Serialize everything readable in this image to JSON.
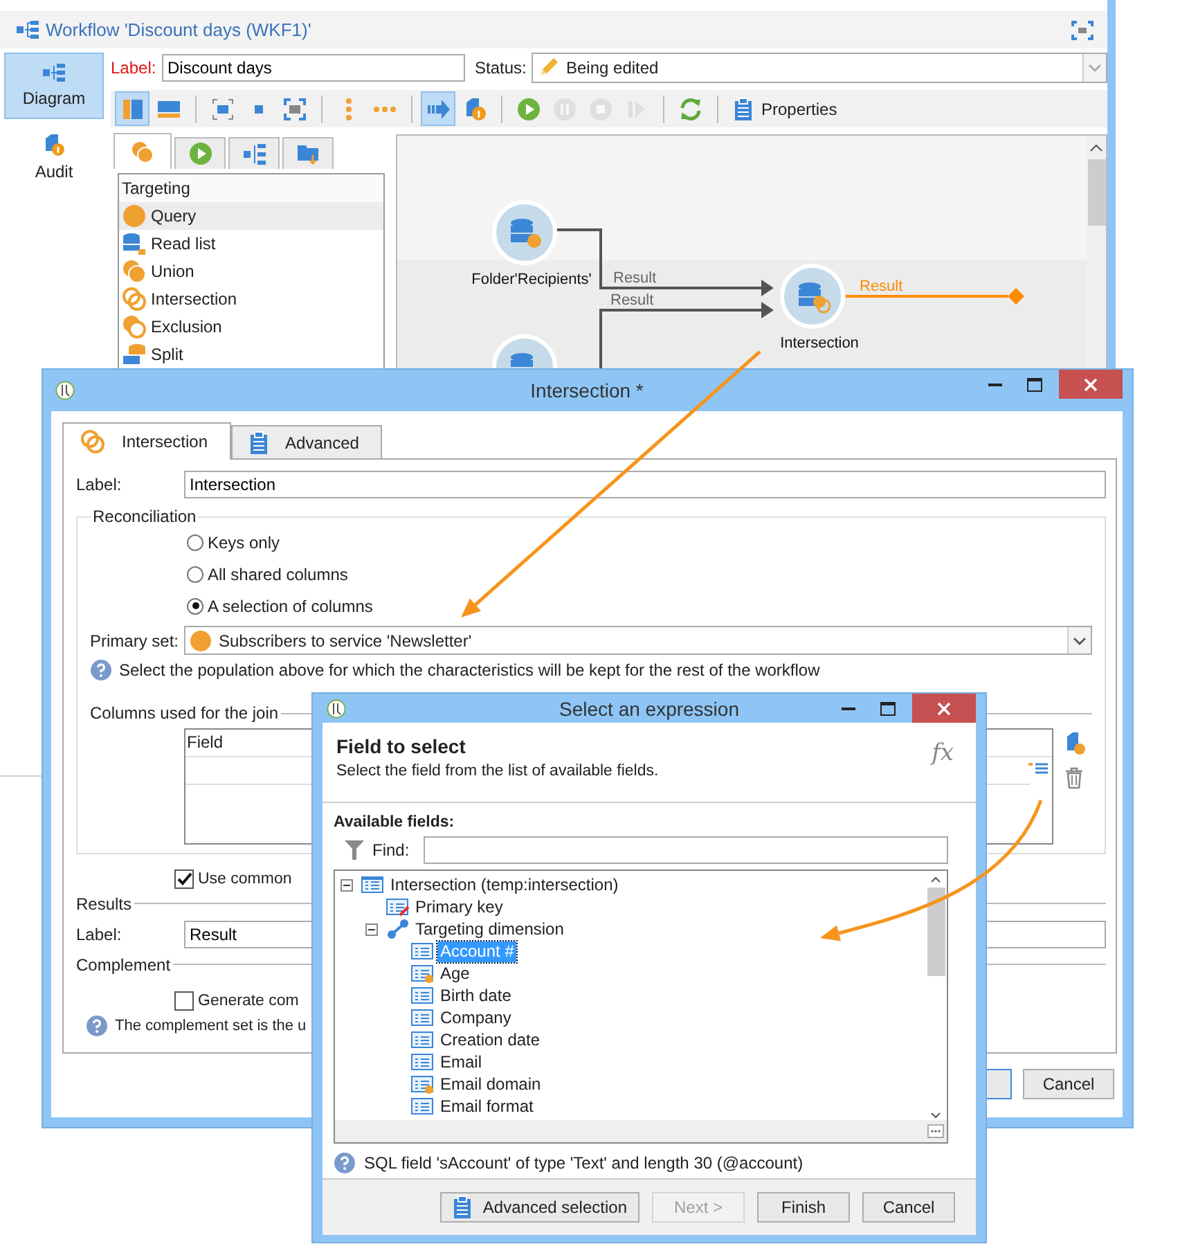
{
  "workflow_window": {
    "title": "Workflow 'Discount days (WKF1)'",
    "sidebar": [
      {
        "label": "Diagram",
        "kind": "diagram",
        "selected": true
      },
      {
        "label": "Audit",
        "kind": "audit",
        "selected": false
      }
    ],
    "label_caption": "Label:",
    "label_value": "Discount days",
    "status_caption": "Status:",
    "status_value": "Being edited",
    "toolbar": {
      "groups": [
        [
          {
            "kind": "vertical-split",
            "pressed": true,
            "disabled": false
          },
          {
            "kind": "horizontal-split",
            "pressed": false,
            "disabled": false
          }
        ],
        [
          {
            "kind": "fit",
            "pressed": false,
            "disabled": false
          },
          {
            "kind": "small-square",
            "pressed": false,
            "disabled": false
          },
          {
            "kind": "fullscreen",
            "pressed": false,
            "disabled": false
          }
        ],
        [
          {
            "kind": "vertical-dots",
            "pressed": false,
            "disabled": false
          },
          {
            "kind": "horizontal-dots",
            "pressed": false,
            "disabled": false
          }
        ],
        [
          {
            "kind": "arrow-right",
            "pressed": true,
            "disabled": false
          },
          {
            "kind": "doc-info",
            "pressed": false,
            "disabled": false
          }
        ],
        [
          {
            "kind": "play",
            "pressed": false,
            "disabled": false
          },
          {
            "kind": "pause",
            "pressed": false,
            "disabled": true
          },
          {
            "kind": "stop",
            "pressed": false,
            "disabled": true
          },
          {
            "kind": "step",
            "pressed": false,
            "disabled": true
          }
        ],
        [
          {
            "kind": "refresh",
            "pressed": false,
            "disabled": false
          }
        ]
      ],
      "properties_label": "Properties"
    },
    "palette": {
      "tabs": [
        {
          "kind": "targeting",
          "selected": true
        },
        {
          "kind": "flow",
          "selected": false
        },
        {
          "kind": "actions",
          "selected": false
        },
        {
          "kind": "tools",
          "selected": false
        }
      ],
      "heading": "Targeting",
      "items": [
        {
          "label": "Query",
          "kind": "query",
          "selected": true
        },
        {
          "label": "Read list",
          "kind": "read-list",
          "selected": false
        },
        {
          "label": "Union",
          "kind": "union",
          "selected": false
        },
        {
          "label": "Intersection",
          "kind": "intersection",
          "selected": false
        },
        {
          "label": "Exclusion",
          "kind": "exclusion",
          "selected": false
        },
        {
          "label": "Split",
          "kind": "split",
          "selected": false
        }
      ]
    },
    "diagram": {
      "nodes": [
        {
          "kind": "query",
          "label": "Folder'Recipients'"
        },
        {
          "kind": "query"
        },
        {
          "kind": "intersection",
          "label": "Intersection"
        }
      ],
      "transitions": [
        {
          "label": "Result",
          "active": false
        },
        {
          "label": "Result",
          "active": false
        },
        {
          "label": "Result",
          "active": true
        }
      ]
    }
  },
  "intersection_dialog": {
    "title": "Intersection *",
    "tabs": [
      {
        "label": "Intersection",
        "kind": "intersection",
        "selected": true
      },
      {
        "label": "Advanced",
        "kind": "advanced",
        "selected": false
      }
    ],
    "label_caption": "Label:",
    "label_value": "Intersection",
    "reconciliation": {
      "legend": "Reconciliation",
      "options": [
        {
          "label": "Keys only",
          "selected": false
        },
        {
          "label": "All shared columns",
          "selected": false
        },
        {
          "label": "A selection of columns",
          "selected": true
        }
      ],
      "primary_set_caption": "Primary set:",
      "primary_set_value": "Subscribers to service 'Newsletter'",
      "hint": "Select the population above for which the characteristics will be kept for the rest of the workflow"
    },
    "columns": {
      "legend": "Columns used for the join",
      "header": "Field"
    },
    "use_common": {
      "label": "Use common",
      "checked": true
    },
    "results": {
      "legend": "Results",
      "label_caption": "Label:",
      "label_value": "Result"
    },
    "complement": {
      "legend": "Complement",
      "checkbox": {
        "label": "Generate com",
        "checked": false
      },
      "hint": "The complement set is the u"
    },
    "cancel_label": "Cancel"
  },
  "select_dialog": {
    "title": "Select an expression",
    "heading": "Field to select",
    "subtitle": "Select the field from the list of available fields.",
    "fx": "fx",
    "available_caption": "Available fields:",
    "find_caption": "Find:",
    "tree": [
      {
        "label": "Intersection (temp:intersection)",
        "kind": "table",
        "expanded": true,
        "selected": false,
        "children": [
          {
            "label": "Primary key",
            "kind": "key",
            "selected": false
          },
          {
            "label": "Targeting dimension",
            "kind": "link",
            "expanded": true,
            "selected": false,
            "children": [
              {
                "label": "Account #",
                "kind": "field",
                "selected": true
              },
              {
                "label": "Age",
                "kind": "computed",
                "selected": false
              },
              {
                "label": "Birth date",
                "kind": "field",
                "selected": false
              },
              {
                "label": "Company",
                "kind": "field",
                "selected": false
              },
              {
                "label": "Creation date",
                "kind": "field",
                "selected": false
              },
              {
                "label": "Email",
                "kind": "field",
                "selected": false
              },
              {
                "label": "Email domain",
                "kind": "computed",
                "selected": false
              },
              {
                "label": "Email format",
                "kind": "field",
                "selected": false
              }
            ]
          }
        ]
      }
    ],
    "hint": "SQL field 'sAccount' of type 'Text' and length 30 (@account)",
    "buttons": [
      {
        "label": "Advanced selection",
        "kind": "advanced",
        "disabled": false
      },
      {
        "label": "Next >",
        "kind": "plain",
        "disabled": true
      },
      {
        "label": "Finish",
        "kind": "plain",
        "disabled": false
      },
      {
        "label": "Cancel",
        "kind": "plain",
        "disabled": false
      }
    ]
  }
}
